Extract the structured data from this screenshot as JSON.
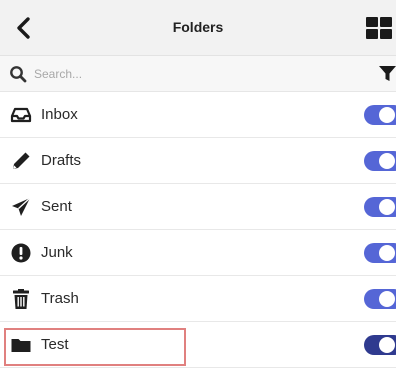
{
  "header": {
    "title": "Folders",
    "back_icon": "chevron-left-icon",
    "grid_icon": "grid-view-icon"
  },
  "search": {
    "placeholder": "Search...",
    "value": "",
    "search_icon": "search-icon",
    "filter_icon": "filter-icon"
  },
  "folders": [
    {
      "label": "Inbox",
      "icon": "inbox-icon",
      "enabled": true
    },
    {
      "label": "Drafts",
      "icon": "pencil-icon",
      "enabled": true
    },
    {
      "label": "Sent",
      "icon": "paper-plane-icon",
      "enabled": true
    },
    {
      "label": "Junk",
      "icon": "exclamation-circle-icon",
      "enabled": true
    },
    {
      "label": "Trash",
      "icon": "trash-icon",
      "enabled": true
    },
    {
      "label": "Test",
      "icon": "folder-icon",
      "enabled": true,
      "highlighted": true
    }
  ],
  "colors": {
    "toggle_on": "#5566d6",
    "toggle_on_dark": "#2f3a8f",
    "highlight": "#e0807f"
  }
}
